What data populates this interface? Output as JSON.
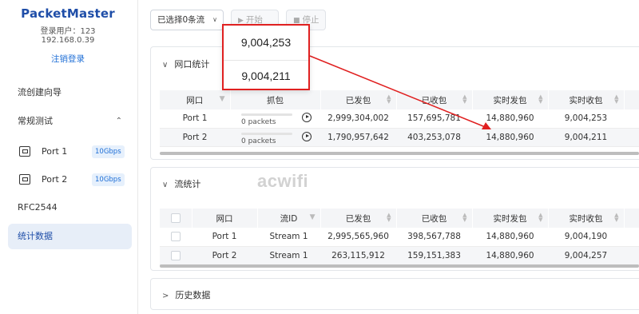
{
  "sidebar": {
    "brand": "PacketMaster",
    "user_line": "登录用户：123",
    "ip": "192.168.0.39",
    "logout": "注销登录",
    "items": [
      {
        "label": "流创建向导"
      },
      {
        "label": "常规测试",
        "expanded": true
      },
      {
        "label": "Port 1",
        "speed": "10Gbps",
        "icon": "ethernet-port-icon"
      },
      {
        "label": "Port 2",
        "speed": "10Gbps",
        "icon": "ethernet-port-icon"
      },
      {
        "label": "RFC2544"
      },
      {
        "label": "统计数据",
        "active": true
      }
    ]
  },
  "toolbar": {
    "select_value": "已选择0条流",
    "start_label": "开始",
    "stop_label": "停止"
  },
  "port_stats": {
    "title": "网口统计",
    "columns": [
      "网口",
      "抓包",
      "已发包",
      "已收包",
      "实时发包",
      "实时收包"
    ],
    "rows": [
      {
        "port": "Port 1",
        "capture": "0 packets",
        "sent": "2,999,304,002",
        "received": "157,695,781",
        "rt_sent": "14,880,960",
        "rt_received": "9,004,253"
      },
      {
        "port": "Port 2",
        "capture": "0 packets",
        "sent": "1,790,957,642",
        "received": "403,253,078",
        "rt_sent": "14,880,960",
        "rt_received": "9,004,211"
      }
    ]
  },
  "flow_stats": {
    "title": "流统计",
    "columns": [
      "网口",
      "流ID",
      "已发包",
      "已收包",
      "实时发包",
      "实时收包"
    ],
    "rows": [
      {
        "port": "Port 1",
        "flow": "Stream 1",
        "sent": "2,995,565,960",
        "received": "398,567,788",
        "rt_sent": "14,880,960",
        "rt_received": "9,004,190"
      },
      {
        "port": "Port 2",
        "flow": "Stream 1",
        "sent": "263,115,912",
        "received": "159,151,383",
        "rt_sent": "14,880,960",
        "rt_received": "9,004,257"
      }
    ]
  },
  "history": {
    "title": "历史数据"
  },
  "callout": {
    "value_1": "9,004,253",
    "value_2": "9,004,211",
    "color": "#e02020"
  },
  "watermark": "acwifi",
  "colors": {
    "brand": "#1f4ea8",
    "link": "#1f6fd6",
    "active_bg": "#e7eef8"
  }
}
